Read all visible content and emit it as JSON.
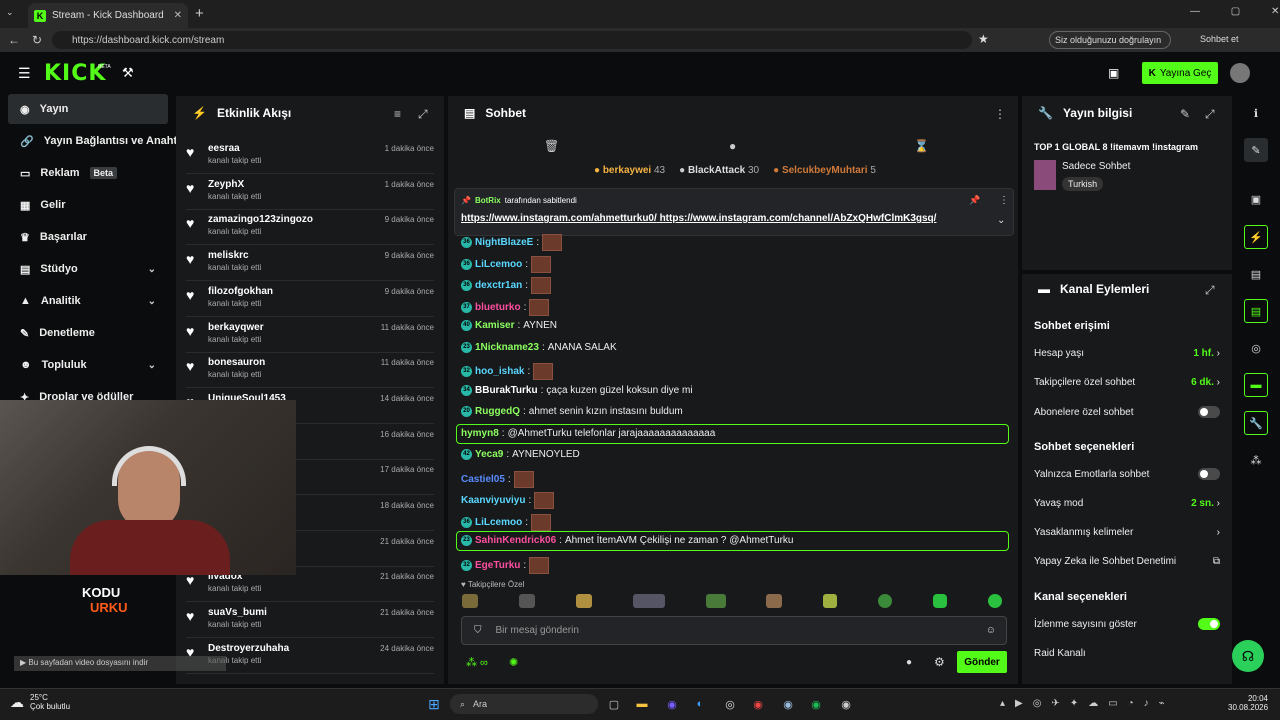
{
  "browser": {
    "tab_title": "Stream - Kick Dashboard",
    "url": "https://dashboard.kick.com/stream",
    "verify": "Siz olduğunuzu doğrulayın",
    "copilot": "Sohbet et"
  },
  "header": {
    "logo": "KICK",
    "beta": "BETA",
    "go_live": "Yayına Geç"
  },
  "nav": [
    {
      "label": "Yayın",
      "active": true
    },
    {
      "label": "Yayın Bağlantısı ve Anahtar"
    },
    {
      "label": "Reklam",
      "badge": "Beta"
    },
    {
      "label": "Gelir"
    },
    {
      "label": "Başarılar"
    },
    {
      "label": "Stüdyo",
      "chev": true
    },
    {
      "label": "Analitik",
      "chev": true
    },
    {
      "label": "Denetleme"
    },
    {
      "label": "Topluluk",
      "chev": true
    },
    {
      "label": "Droplar ve ödüller"
    }
  ],
  "events": {
    "title": "Etkinlik Akışı",
    "items": [
      {
        "name": "eesraa",
        "sub": "kanalı takip etti",
        "time": "1 dakika önce"
      },
      {
        "name": "ZeyphX",
        "sub": "kanalı takip etti",
        "time": "1 dakika önce"
      },
      {
        "name": "zamazingo123zingozo",
        "sub": "kanalı takip etti",
        "time": "9 dakika önce"
      },
      {
        "name": "meliskrc",
        "sub": "kanalı takip etti",
        "time": "9 dakika önce"
      },
      {
        "name": "filozofgokhan",
        "sub": "kanalı takip etti",
        "time": "9 dakika önce"
      },
      {
        "name": "berkayqwer",
        "sub": "kanalı takip etti",
        "time": "11 dakika önce"
      },
      {
        "name": "bonesauron",
        "sub": "kanalı takip etti",
        "time": "11 dakika önce"
      },
      {
        "name": "UniqueSoul1453",
        "sub": "kanalı takip etti",
        "time": "14 dakika önce"
      },
      {
        "name": "",
        "sub": "",
        "time": "16 dakika önce"
      },
      {
        "name": "",
        "sub": "",
        "time": "17 dakika önce"
      },
      {
        "name": "",
        "sub": "",
        "time": "18 dakika önce"
      },
      {
        "name": "",
        "sub": "",
        "time": "21 dakika önce"
      },
      {
        "name": "livadox",
        "sub": "kanalı takip etti",
        "time": "21 dakika önce"
      },
      {
        "name": "suaVs_bumi",
        "sub": "kanalı takip etti",
        "time": "21 dakika önce"
      },
      {
        "name": "Destroyerzuhaha",
        "sub": "kanalı takip etti",
        "time": "24 dakika önce"
      }
    ]
  },
  "overlay": {
    "line1": "KODU",
    "line2": "URKU",
    "download": "Bu sayfadan video dosyasını indir"
  },
  "chat": {
    "title": "Sohbet",
    "top": [
      {
        "name": "berkaywei",
        "n": "43"
      },
      {
        "name": "BlackAttack",
        "n": "30"
      },
      {
        "name": "SelcukbeyMuhtari",
        "n": "5"
      }
    ],
    "pinned_by": "BotRix",
    "pinned_suffix": "tarafından sabitlendi",
    "pinned_link1": "https://www.instagram.com/ahmetturku0/",
    "pinned_link2": "https://www.instagram.com/channel/AbZxQHwfClmK3gsq/",
    "messages": [
      {
        "lvl": "36",
        "user": "NightBlazeE",
        "color": "#5ad8ff",
        "text": "",
        "emote": true
      },
      {
        "lvl": "36",
        "user": "LiLcemoo",
        "color": "#5ad8ff",
        "text": "",
        "emote": true
      },
      {
        "lvl": "36",
        "user": "dexctr1an",
        "color": "#5ad8ff",
        "text": "",
        "emote": true
      },
      {
        "lvl": "37",
        "user": "blueturko",
        "color": "#ff4fa0",
        "text": "",
        "emote": true
      },
      {
        "lvl": "40",
        "user": "Kamiser",
        "color": "#8cff60",
        "text": "AYNEN"
      },
      {
        "lvl": "23",
        "user": "1Nickname23",
        "color": "#8cff60",
        "text": "ANANA SALAK"
      },
      {
        "lvl": "32",
        "user": "hoo_ishak",
        "color": "#5ad8ff",
        "text": "",
        "emote": true
      },
      {
        "lvl": "34",
        "user": "BBurakTurku",
        "color": "#fff",
        "text": "çaça kuzen güzel koksun diye mi"
      },
      {
        "lvl": "20",
        "user": "RuggedQ",
        "color": "#8cff60",
        "text": "ahmet senin kızın instasını buldum"
      },
      {
        "lvl": "",
        "user": "hymyn8",
        "color": "#8cff60",
        "text": "@AhmetTurku telefonlar jarajaaaaaaaaaaaaaa",
        "hl": true
      },
      {
        "lvl": "42",
        "user": "Yeca9",
        "color": "#8cff60",
        "text": "AYNENOYLED"
      },
      {
        "lvl": "",
        "user": "Castiel05",
        "color": "#5a8bff",
        "text": "",
        "emote": true
      },
      {
        "lvl": "",
        "user": "Kaanviyuviyu",
        "color": "#5ad8ff",
        "text": "",
        "emote": true
      },
      {
        "lvl": "36",
        "user": "LiLcemoo",
        "color": "#5ad8ff",
        "text": "",
        "emote": true
      },
      {
        "lvl": "23",
        "user": "SahinKendrick06",
        "color": "#ff4fa0",
        "text": "Ahmet İtemAVM Çekilişi ne zaman ? @AhmetTurku",
        "hl": true
      },
      {
        "lvl": "32",
        "user": "EgeTurku",
        "color": "#ff4fa0",
        "text": "",
        "emote": true
      }
    ],
    "followers_only": "Takipçilere Özel",
    "placeholder": "Bir mesaj gönderin",
    "send": "Gönder"
  },
  "stream_info": {
    "title": "Yayın bilgisi",
    "stream_title": "TOP 1 GLOBAL 8 !itemavm !instagram",
    "category": "Sadece Sohbet",
    "tag": "Turkish"
  },
  "channel_actions": {
    "title": "Kanal Eylemleri",
    "sec1": "Sohbet erişimi",
    "account_age": "Hesap yaşı",
    "account_age_val": "1 hf.",
    "followers_chat": "Takipçilere özel sohbet",
    "followers_chat_val": "6 dk.",
    "subs_chat": "Abonelere özel sohbet",
    "sec2": "Sohbet seçenekleri",
    "emote_only": "Yalnızca Emotlarla sohbet",
    "slow_mode": "Yavaş mod",
    "slow_mode_val": "2 sn.",
    "banned_words": "Yasaklanmış kelimeler",
    "ai_mod": "Yapay Zeka ile Sohbet Denetimi",
    "sec3": "Kanal seçenekleri",
    "show_viewers": "İzlenme sayısını göster",
    "raid": "Raid Kanalı"
  },
  "taskbar": {
    "weather_temp": "25°C",
    "weather_desc": "Çok bulutlu",
    "search": "Ara",
    "time": "20:04",
    "date": "30.08.2026"
  },
  "colors": {
    "accent": "#53fc18"
  }
}
